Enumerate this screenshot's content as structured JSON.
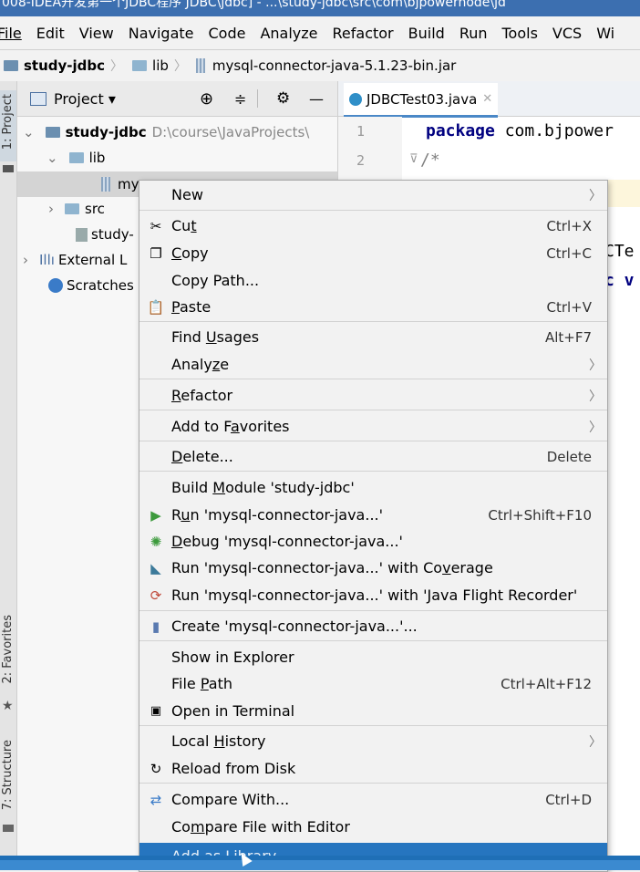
{
  "window": {
    "title": "008-IDEA开发第一个JDBC程序 JDBC\\jdbc] - ...\\study-jdbc\\src\\com\\bjpowernode\\jd"
  },
  "menubar": [
    "File",
    "Edit",
    "View",
    "Navigate",
    "Code",
    "Analyze",
    "Refactor",
    "Build",
    "Run",
    "Tools",
    "VCS",
    "Wi"
  ],
  "breadcrumb": [
    "study-jdbc",
    "lib",
    "mysql-connector-java-5.1.23-bin.jar"
  ],
  "left_tool_tabs": [
    "1: Project",
    "2: Favorites",
    "7: Structure"
  ],
  "project_panel": {
    "title": "Project",
    "tree": [
      {
        "label": "study-jdbc",
        "path": "D:\\course\\JavaProjects\\"
      },
      {
        "label": "lib"
      },
      {
        "label": "my"
      },
      {
        "label": "src"
      },
      {
        "label": "study-"
      },
      {
        "label": "External L"
      },
      {
        "label": "Scratches"
      }
    ]
  },
  "editor": {
    "tab": "JDBCTest03.java",
    "lines": [
      {
        "n": "1",
        "keyword": "package",
        "text": " com.bjpower"
      },
      {
        "n": "2",
        "text": "/*"
      }
    ],
    "frag1": "CTe",
    "frag2": "c v"
  },
  "context_menu": [
    {
      "label": "New",
      "arrow": true
    },
    {
      "label": "Cut",
      "shortcut": "Ctrl+X",
      "icon": "scissors-icon"
    },
    {
      "label": "Copy",
      "shortcut": "Ctrl+C",
      "icon": "copy-icon"
    },
    {
      "label": "Copy Path..."
    },
    {
      "label": "Paste",
      "shortcut": "Ctrl+V",
      "icon": "paste-icon"
    },
    {
      "label": "Find Usages",
      "shortcut": "Alt+F7"
    },
    {
      "label": "Analyze",
      "arrow": true
    },
    {
      "label": "Refactor",
      "arrow": true
    },
    {
      "label": "Add to Favorites",
      "arrow": true
    },
    {
      "label": "Delete...",
      "shortcut": "Delete"
    },
    {
      "label": "Build Module 'study-jdbc'"
    },
    {
      "label": "Run 'mysql-connector-java...'",
      "shortcut": "Ctrl+Shift+F10",
      "icon": "run-icon"
    },
    {
      "label": "Debug 'mysql-connector-java...'",
      "icon": "debug-icon"
    },
    {
      "label": "Run 'mysql-connector-java...' with Coverage",
      "icon": "coverage-icon"
    },
    {
      "label": "Run 'mysql-connector-java...' with 'Java Flight Recorder'",
      "icon": "flight-recorder-icon"
    },
    {
      "label": "Create 'mysql-connector-java...'...",
      "icon": "create-config-icon"
    },
    {
      "label": "Show in Explorer"
    },
    {
      "label": "File Path",
      "shortcut": "Ctrl+Alt+F12"
    },
    {
      "label": "Open in Terminal",
      "icon": "terminal-icon"
    },
    {
      "label": "Local History",
      "arrow": true
    },
    {
      "label": "Reload from Disk",
      "icon": "reload-icon"
    },
    {
      "label": "Compare With...",
      "shortcut": "Ctrl+D",
      "icon": "compare-icon"
    },
    {
      "label": "Compare File with Editor"
    },
    {
      "label": "Add as Library..."
    }
  ]
}
